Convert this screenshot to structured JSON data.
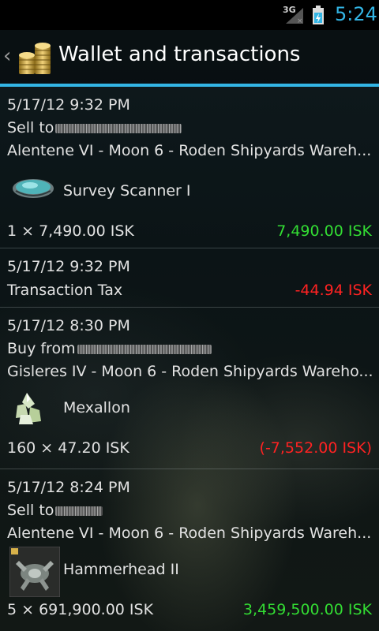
{
  "status_bar": {
    "network": "3G",
    "time": "5:24",
    "accent": "#33b5e5"
  },
  "action_bar": {
    "title": "Wallet and transactions",
    "back_icon": "chevron-left-icon",
    "app_icon": "coin-stack-icon"
  },
  "transactions": [
    {
      "datetime": "5/17/12 9:32 PM",
      "party_prefix": "Sell to",
      "location": "Alentene VI - Moon 6 - Roden Shipyards Wareh...",
      "item_name": "Survey Scanner I",
      "item_icon": "survey-scanner-icon",
      "quantity_price": "1 × 7,490.00 ISK",
      "total": "7,490.00 ISK",
      "total_color": "#33dd33"
    },
    {
      "datetime": "5/17/12 9:32 PM",
      "label": "Transaction Tax",
      "total": "-44.94 ISK",
      "total_color": "#ff2222"
    },
    {
      "datetime": "5/17/12 8:30 PM",
      "party_prefix": "Buy from",
      "location": "Gisleres IV - Moon 6 - Roden Shipyards Wareho...",
      "item_name": "Mexallon",
      "item_icon": "mineral-crystal-icon",
      "quantity_price": "160 × 47.20 ISK",
      "total": "(-7,552.00 ISK)",
      "total_color": "#ff2222"
    },
    {
      "datetime": "5/17/12 8:24 PM",
      "party_prefix": "Sell to",
      "location": "Alentene VI - Moon 6 - Roden Shipyards Wareh...",
      "item_name": "Hammerhead II",
      "item_icon": "drone-icon",
      "quantity_price": "5 × 691,900.00 ISK",
      "total": "3,459,500.00 ISK",
      "total_color": "#33dd33"
    }
  ]
}
